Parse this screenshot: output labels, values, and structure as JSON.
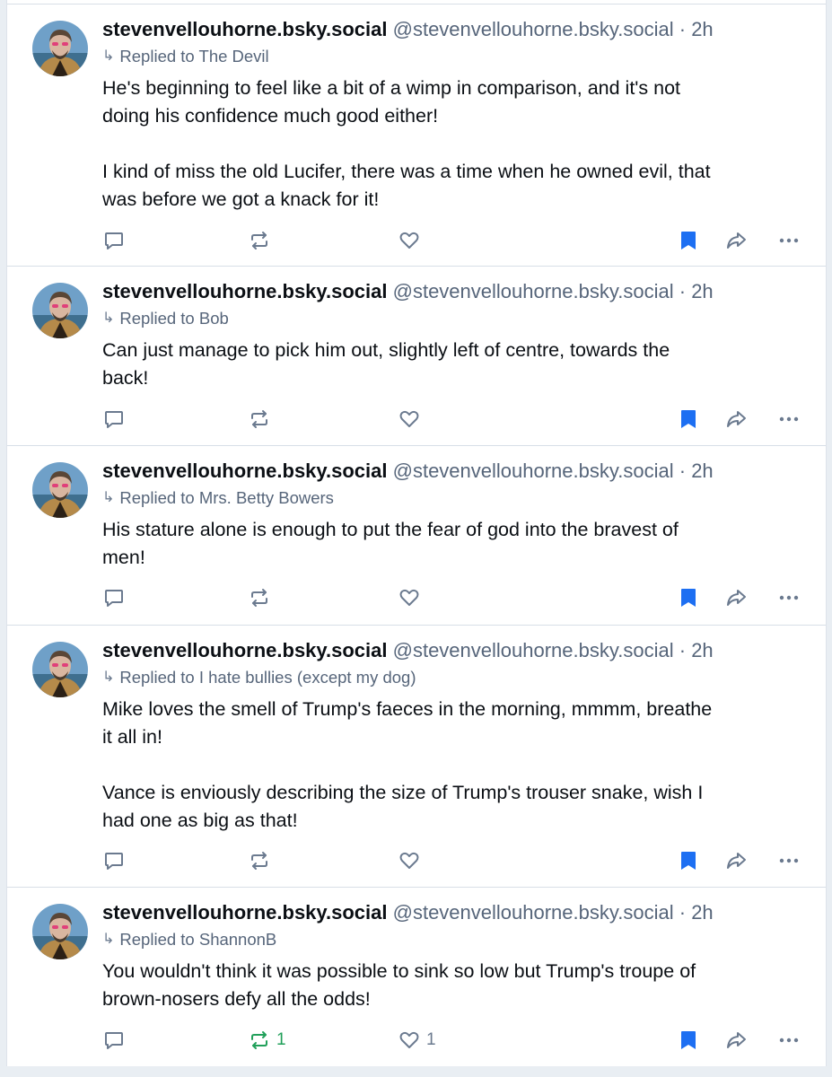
{
  "posts": [
    {
      "display_name": "stevenvellouhorne.bsky.social",
      "handle": "@stevenvellouhorne.bsky.social",
      "separator": "·",
      "time": "2h",
      "reply_to": "Replied to The Devil",
      "text": "He's beginning to feel like a bit of a wimp in comparison, and it's not\ndoing his confidence much good either!\n\nI kind of miss the old Lucifer, there was a time when he owned evil, that\nwas before we got a knack for it!",
      "reposts": "",
      "likes": "",
      "reposted": false
    },
    {
      "display_name": "stevenvellouhorne.bsky.social",
      "handle": "@stevenvellouhorne.bsky.social",
      "separator": "·",
      "time": "2h",
      "reply_to": "Replied to Bob",
      "text": "Can just manage to pick him out, slightly left of centre, towards the\nback!",
      "reposts": "",
      "likes": "",
      "reposted": false
    },
    {
      "display_name": "stevenvellouhorne.bsky.social",
      "handle": "@stevenvellouhorne.bsky.social",
      "separator": "·",
      "time": "2h",
      "reply_to": "Replied to Mrs. Betty Bowers",
      "text": "His stature alone is enough to put the fear of god into the bravest of\nmen!",
      "reposts": "",
      "likes": "",
      "reposted": false
    },
    {
      "display_name": "stevenvellouhorne.bsky.social",
      "handle": "@stevenvellouhorne.bsky.social",
      "separator": "·",
      "time": "2h",
      "reply_to": "Replied to I hate bullies (except my dog)",
      "text": "Mike loves the smell of Trump's faeces in the morning, mmmm, breathe\nit all in!\n\nVance is enviously describing the size of Trump's trouser snake, wish I\nhad one as big as that!",
      "reposts": "",
      "likes": "",
      "reposted": false
    },
    {
      "display_name": "stevenvellouhorne.bsky.social",
      "handle": "@stevenvellouhorne.bsky.social",
      "separator": "·",
      "time": "2h",
      "reply_to": "Replied to ShannonB",
      "text": "You wouldn't think it was possible to sink so low but Trump's troupe of\nbrown-nosers defy all the odds!",
      "reposts": "1",
      "likes": "1",
      "reposted": true
    }
  ],
  "colors": {
    "text_primary": "#0b0f14",
    "text_secondary": "#56657a",
    "icon_gray": "#6b7a8f",
    "bookmark_blue": "#1d6ff2",
    "repost_green": "#21a05a",
    "divider": "#d8dfe7"
  },
  "icons": {
    "reply": "speech-bubble-icon",
    "repost": "repost-arrows-icon",
    "like": "heart-icon",
    "bookmark": "bookmark-filled-icon",
    "share": "share-arrow-icon",
    "more": "ellipsis-icon"
  }
}
